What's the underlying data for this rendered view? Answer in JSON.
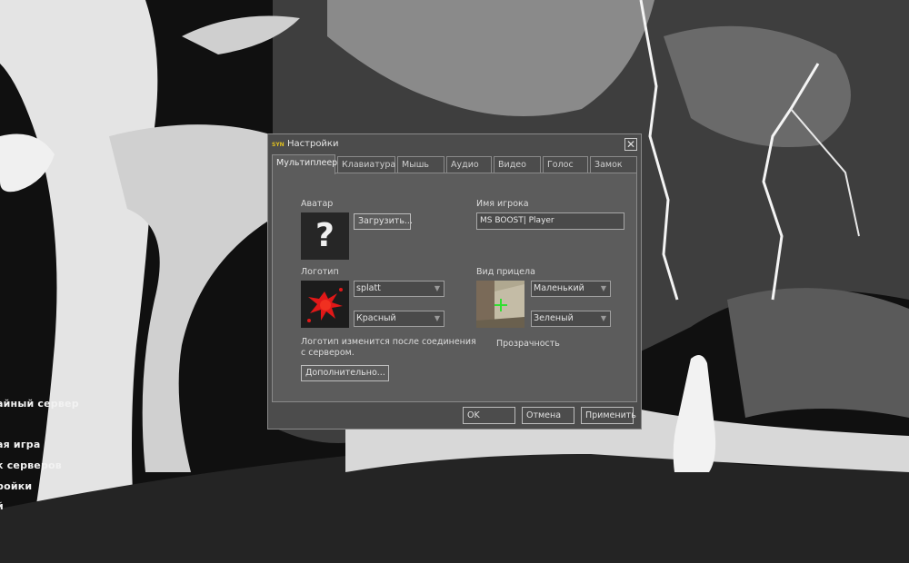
{
  "main_menu": {
    "items": [
      "айный сервер",
      "ая игра",
      "к серверов",
      "ройки",
      "й"
    ]
  },
  "dialog": {
    "title": "Настройки",
    "title_logo": "SYN",
    "close_icon": "close-icon",
    "tabs": [
      "Мультиплеер",
      "Клавиатура",
      "Мышь",
      "Аудио",
      "Видео",
      "Голос",
      "Замок"
    ],
    "active_tab": "Мультиплеер",
    "multiplayer": {
      "avatar_label": "Аватар",
      "avatar_placeholder": "?",
      "upload_button": "Загрузить...",
      "player_name_label": "Имя игрока",
      "player_name_value": "MS BOOST| Player",
      "logo_label": "Логотип",
      "logo_select": "splatt",
      "logo_color_select": "Красный",
      "logo_note": [
        "Логотип изменится после соединения",
        "с сервером."
      ],
      "advanced_button": "Дополнительно...",
      "crosshair_label": "Вид прицела",
      "crosshair_size_select": "Маленький",
      "crosshair_color_select": "Зеленый",
      "transparency_label": "Прозрачность"
    },
    "buttons": {
      "ok": "OK",
      "cancel": "Отмена",
      "apply": "Применить"
    }
  }
}
